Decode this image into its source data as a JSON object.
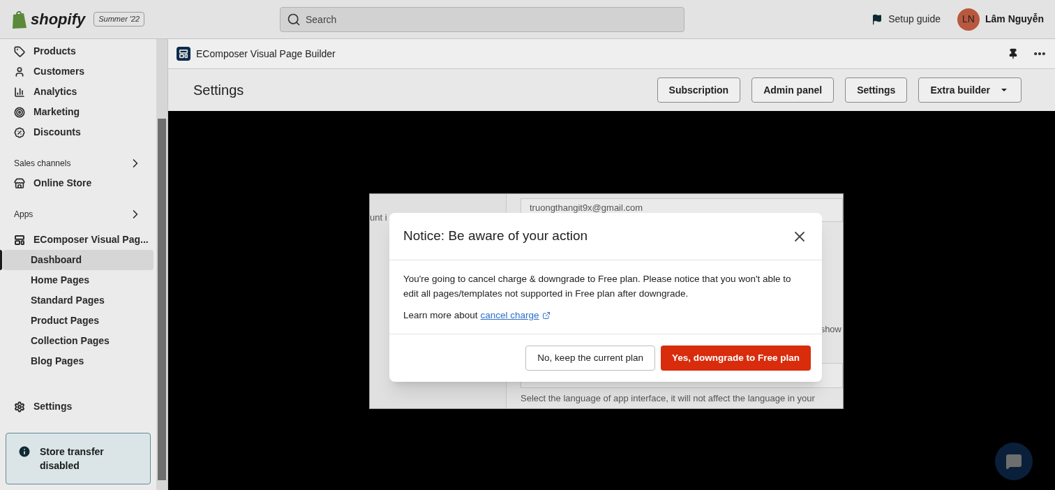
{
  "topbar": {
    "logo": "shopify",
    "badge": "Summer '22",
    "search": {
      "placeholder": "Search"
    },
    "setup_guide": "Setup guide",
    "user": {
      "initials": "LN",
      "name": "Lâm Nguyễn"
    }
  },
  "sidebar": {
    "items": [
      {
        "label": "Products",
        "kind": "nav",
        "selected": false
      },
      {
        "label": "Customers",
        "kind": "nav",
        "selected": false
      },
      {
        "label": "Analytics",
        "kind": "nav",
        "selected": false
      },
      {
        "label": "Marketing",
        "kind": "nav",
        "selected": false
      },
      {
        "label": "Discounts",
        "kind": "nav",
        "selected": false
      },
      {
        "label": "Sales channels",
        "kind": "section",
        "selected": false
      },
      {
        "label": "Online Store",
        "kind": "nav",
        "selected": false
      },
      {
        "label": "Apps",
        "kind": "section",
        "selected": false
      },
      {
        "label": "EComposer Visual Pag...",
        "kind": "app",
        "selected": false
      },
      {
        "label": "Dashboard",
        "kind": "sub",
        "selected": true
      },
      {
        "label": "Home Pages",
        "kind": "sub",
        "selected": false
      },
      {
        "label": "Standard Pages",
        "kind": "sub",
        "selected": false
      },
      {
        "label": "Product Pages",
        "kind": "sub",
        "selected": false
      },
      {
        "label": "Collection Pages",
        "kind": "sub",
        "selected": false
      },
      {
        "label": "Blog Pages",
        "kind": "sub",
        "selected": false
      }
    ],
    "settings": "Settings",
    "notice": "Store transfer disabled"
  },
  "app_header": {
    "title": "EComposer Visual Page Builder"
  },
  "page": {
    "title": "Settings",
    "buttons": [
      {
        "label": "Subscription",
        "kind": "plain"
      },
      {
        "label": "Admin panel",
        "kind": "plain"
      },
      {
        "label": "Settings",
        "kind": "plain"
      },
      {
        "label": "Extra builder",
        "kind": "dropdown"
      }
    ]
  },
  "background_dialog": {
    "left_text": "unt i",
    "email": "truongthangit9x@gmail.com",
    "side_text": "show",
    "language_hint": "Select the language of app interface, it will not affect the language in your"
  },
  "modal": {
    "title": "Notice: Be aware of your action",
    "body": "You're going to cancel charge & downgrade to Free plan. Please notice that you won't able to edit all pages/templates not supported in Free plan after downgrade.",
    "learn_more": {
      "text": "Learn more about",
      "link": "cancel charge"
    },
    "buttons": [
      {
        "label": "No, keep the current plan",
        "kind": "secondary"
      },
      {
        "label": "Yes, downgrade to Free plan",
        "kind": "primary"
      }
    ]
  }
}
